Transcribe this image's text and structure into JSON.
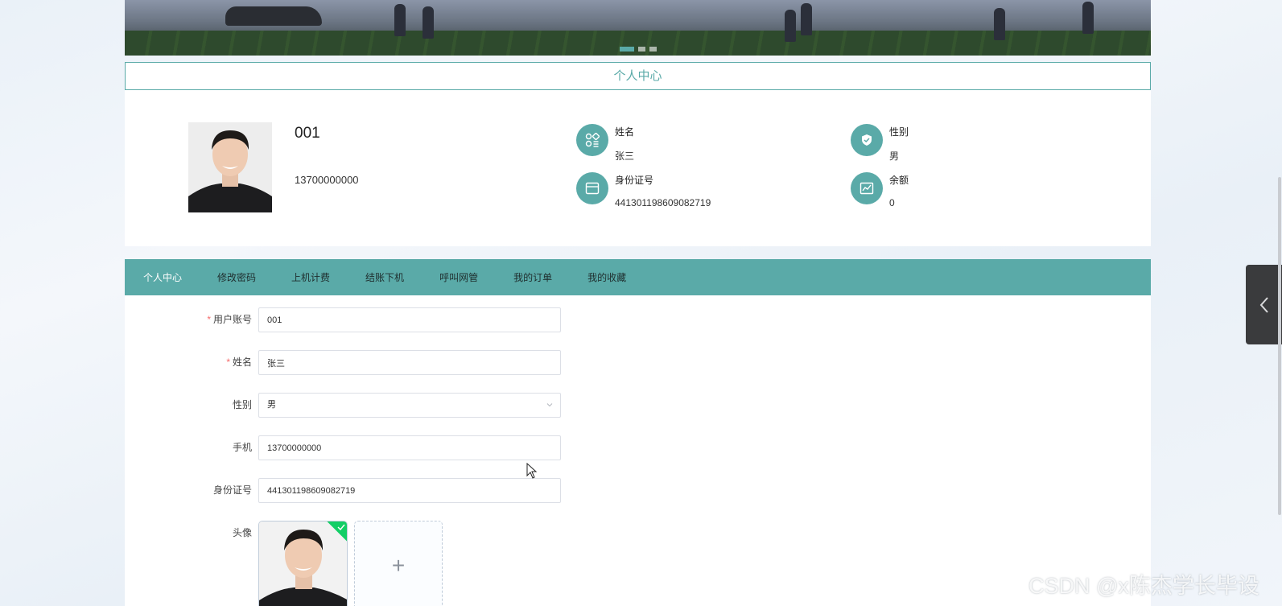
{
  "banner": {
    "carousel_dots": 3,
    "active_dot": 0
  },
  "section_title": "个人中心",
  "profile": {
    "username": "001",
    "phone": "13700000000",
    "fields": {
      "name_label": "姓名",
      "name_value": "张三",
      "gender_label": "性别",
      "gender_value": "男",
      "idcard_label": "身份证号",
      "idcard_value": "441301198609082719",
      "balance_label": "余额",
      "balance_value": "0"
    },
    "icons": {
      "name": "grid-apps-icon",
      "gender": "shield-check-icon",
      "idcard": "card-icon",
      "balance": "chart-icon"
    }
  },
  "tabs": [
    {
      "label": "个人中心",
      "active": true
    },
    {
      "label": "修改密码",
      "active": false
    },
    {
      "label": "上机计费",
      "active": false
    },
    {
      "label": "结账下机",
      "active": false
    },
    {
      "label": "呼叫网管",
      "active": false
    },
    {
      "label": "我的订单",
      "active": false
    },
    {
      "label": "我的收藏",
      "active": false
    }
  ],
  "form": {
    "account_label": "用户账号",
    "account_value": "001",
    "name_label": "姓名",
    "name_value": "张三",
    "gender_label": "性别",
    "gender_value": "男",
    "phone_label": "手机",
    "phone_value": "13700000000",
    "idcard_label": "身份证号",
    "idcard_value": "441301198609082719",
    "avatar_label": "头像",
    "required_mark": "*",
    "upload_plus": "+"
  },
  "watermark": "CSDN @x陈杰学长毕设",
  "colors": {
    "accent": "#5aaaa8",
    "required": "#f56c6c",
    "success": "#13ce66"
  }
}
